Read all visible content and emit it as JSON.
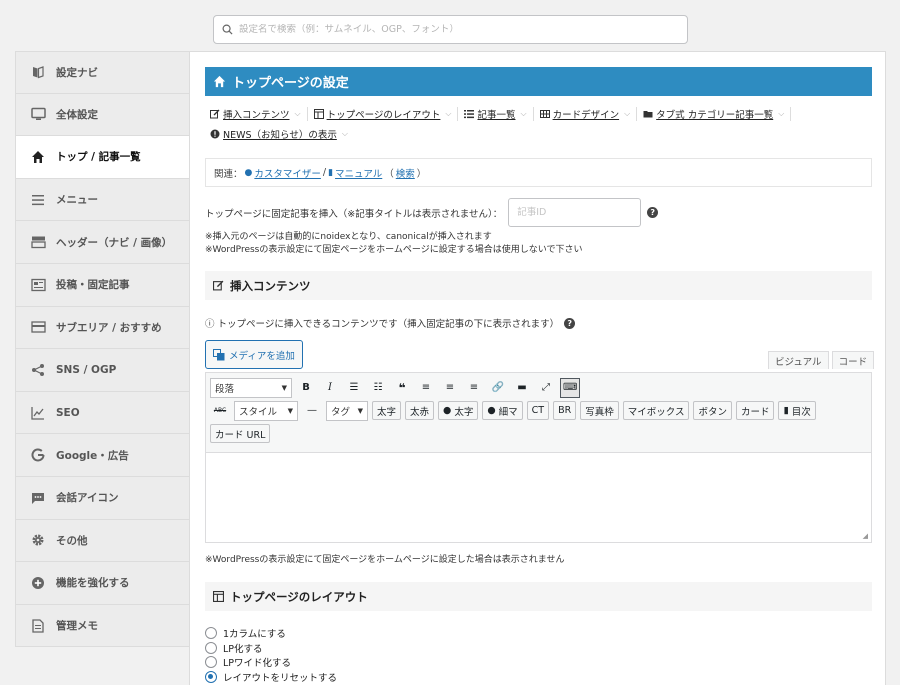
{
  "search": {
    "placeholder": "設定名で検索（例：サムネイル、OGP、フォント）"
  },
  "sidebar": {
    "items": [
      {
        "label": "設定ナビ",
        "icon": "book-icon",
        "active": false
      },
      {
        "label": "全体設定",
        "icon": "monitor-icon",
        "active": false
      },
      {
        "label": "トップ / 記事一覧",
        "icon": "home-icon",
        "active": true
      },
      {
        "label": "メニュー",
        "icon": "hamburger-icon",
        "active": false
      },
      {
        "label": "ヘッダー（ナビ / 画像）",
        "icon": "header-icon",
        "active": false
      },
      {
        "label": "投稿・固定記事",
        "icon": "post-icon",
        "active": false
      },
      {
        "label": "サブエリア / おすすめ",
        "icon": "card-icon",
        "active": false
      },
      {
        "label": "SNS / OGP",
        "icon": "share-icon",
        "active": false
      },
      {
        "label": "SEO",
        "icon": "chart-line-icon",
        "active": false
      },
      {
        "label": "Google・広告",
        "icon": "google-icon",
        "active": false
      },
      {
        "label": "会話アイコン",
        "icon": "chat-icon",
        "active": false
      },
      {
        "label": "その他",
        "icon": "gear-icon",
        "active": false
      },
      {
        "label": "機能を強化する",
        "icon": "plus-circle-icon",
        "active": false
      },
      {
        "label": "管理メモ",
        "icon": "memo-icon",
        "active": false
      }
    ]
  },
  "page": {
    "title": "トップページの設定"
  },
  "tabs": [
    {
      "label": "挿入コンテンツ",
      "icon": "edit-icon"
    },
    {
      "label": "トップページのレイアウト",
      "icon": "layout-icon"
    },
    {
      "label": "記事一覧",
      "icon": "list-icon"
    },
    {
      "label": "カードデザイン",
      "icon": "grid-icon"
    },
    {
      "label": "タブ式 カテゴリー記事一覧",
      "icon": "folder-icon"
    },
    {
      "label": "NEWS（お知らせ）の表示",
      "icon": "alert-circle-icon"
    }
  ],
  "related": {
    "prefix": "関連：",
    "customizer": "カスタマイザー",
    "sep": "/",
    "manual": "マニュアル",
    "search_open": "（",
    "search": "検索",
    "search_close": "）"
  },
  "fixed": {
    "label": "トップページに固定記事を挿入（※記事タイトルは表示されません）：",
    "placeholder": "記事ID",
    "note1": "※挿入元のページは自動的にnoidexとなり、canonicalが挿入されます",
    "note2": "※WordPressの表示設定にて固定ページをホームページに設定する場合は使用しないで下さい"
  },
  "insert_section": {
    "title": "挿入コンテンツ",
    "info": "ⓘ トップページに挿入できるコンテンツです（挿入固定記事の下に表示されます）",
    "media_button": "メディアを追加",
    "visual_tab": "ビジュアル",
    "code_tab": "コード",
    "format_select": "段落",
    "style_select": "スタイル",
    "tag_select": "タグ",
    "quicktags": [
      "太字",
      "太赤",
      "太字",
      "細マ",
      "CT",
      "BR",
      "写真枠",
      "マイボックス",
      "ボタン",
      "カード",
      "目次",
      "カード URL"
    ],
    "bottom_note": "※WordPressの表示設定にて固定ページをホームページに設定した場合は表示されません"
  },
  "layout_section": {
    "title": "トップページのレイアウト",
    "options": [
      {
        "label": "1カラムにする",
        "checked": false
      },
      {
        "label": "LP化する",
        "checked": false
      },
      {
        "label": "LPワイド化する",
        "checked": false
      },
      {
        "label": "レイアウトをリセットする",
        "checked": true
      }
    ]
  },
  "colors": {
    "accent": "#2e8cc1",
    "link": "#2271b1"
  }
}
